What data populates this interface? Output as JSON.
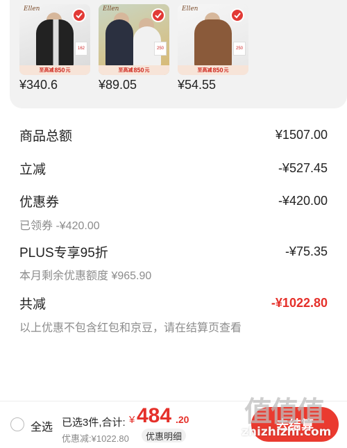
{
  "products": [
    {
      "price": "¥340.6",
      "promo_prefix": "至高减",
      "promo_amount": "850",
      "promo_suffix": "元",
      "brand": "Ellen",
      "tag": "162"
    },
    {
      "price": "¥89.05",
      "promo_prefix": "至高减",
      "promo_amount": "850",
      "promo_suffix": "元",
      "brand": "Ellen",
      "tag": "250"
    },
    {
      "price": "¥54.55",
      "promo_prefix": "至高减",
      "promo_amount": "850",
      "promo_suffix": "元",
      "brand": "Ellen",
      "tag": "250"
    }
  ],
  "summary": {
    "goods_total_label": "商品总额",
    "goods_total_value": "¥1507.00",
    "instant_label": "立减",
    "instant_value": "-¥527.45",
    "coupon_label": "优惠券",
    "coupon_value": "-¥420.00",
    "coupon_sub": "已领券 -¥420.00",
    "plus_label": "PLUS专享95折",
    "plus_value": "-¥75.35",
    "plus_sub": "本月剩余优惠额度 ¥965.90",
    "total_discount_label": "共减",
    "total_discount_value": "-¥1022.80",
    "note": "以上优惠不包含红包和京豆，请在结算页查看"
  },
  "bottom_bar": {
    "select_all": "全选",
    "selected_text": "已选3件,合计:",
    "currency": "¥",
    "total_int": "484",
    "total_dec": ".20",
    "discount_line": "优惠减:¥1022.80",
    "detail_button": "优惠明细",
    "checkout_button": "去结算"
  },
  "watermark": {
    "chars": "值值值",
    "url": "zhizhizhi.com"
  },
  "colors": {
    "accent": "#e5302a",
    "checkout": "#ea3a2f"
  }
}
